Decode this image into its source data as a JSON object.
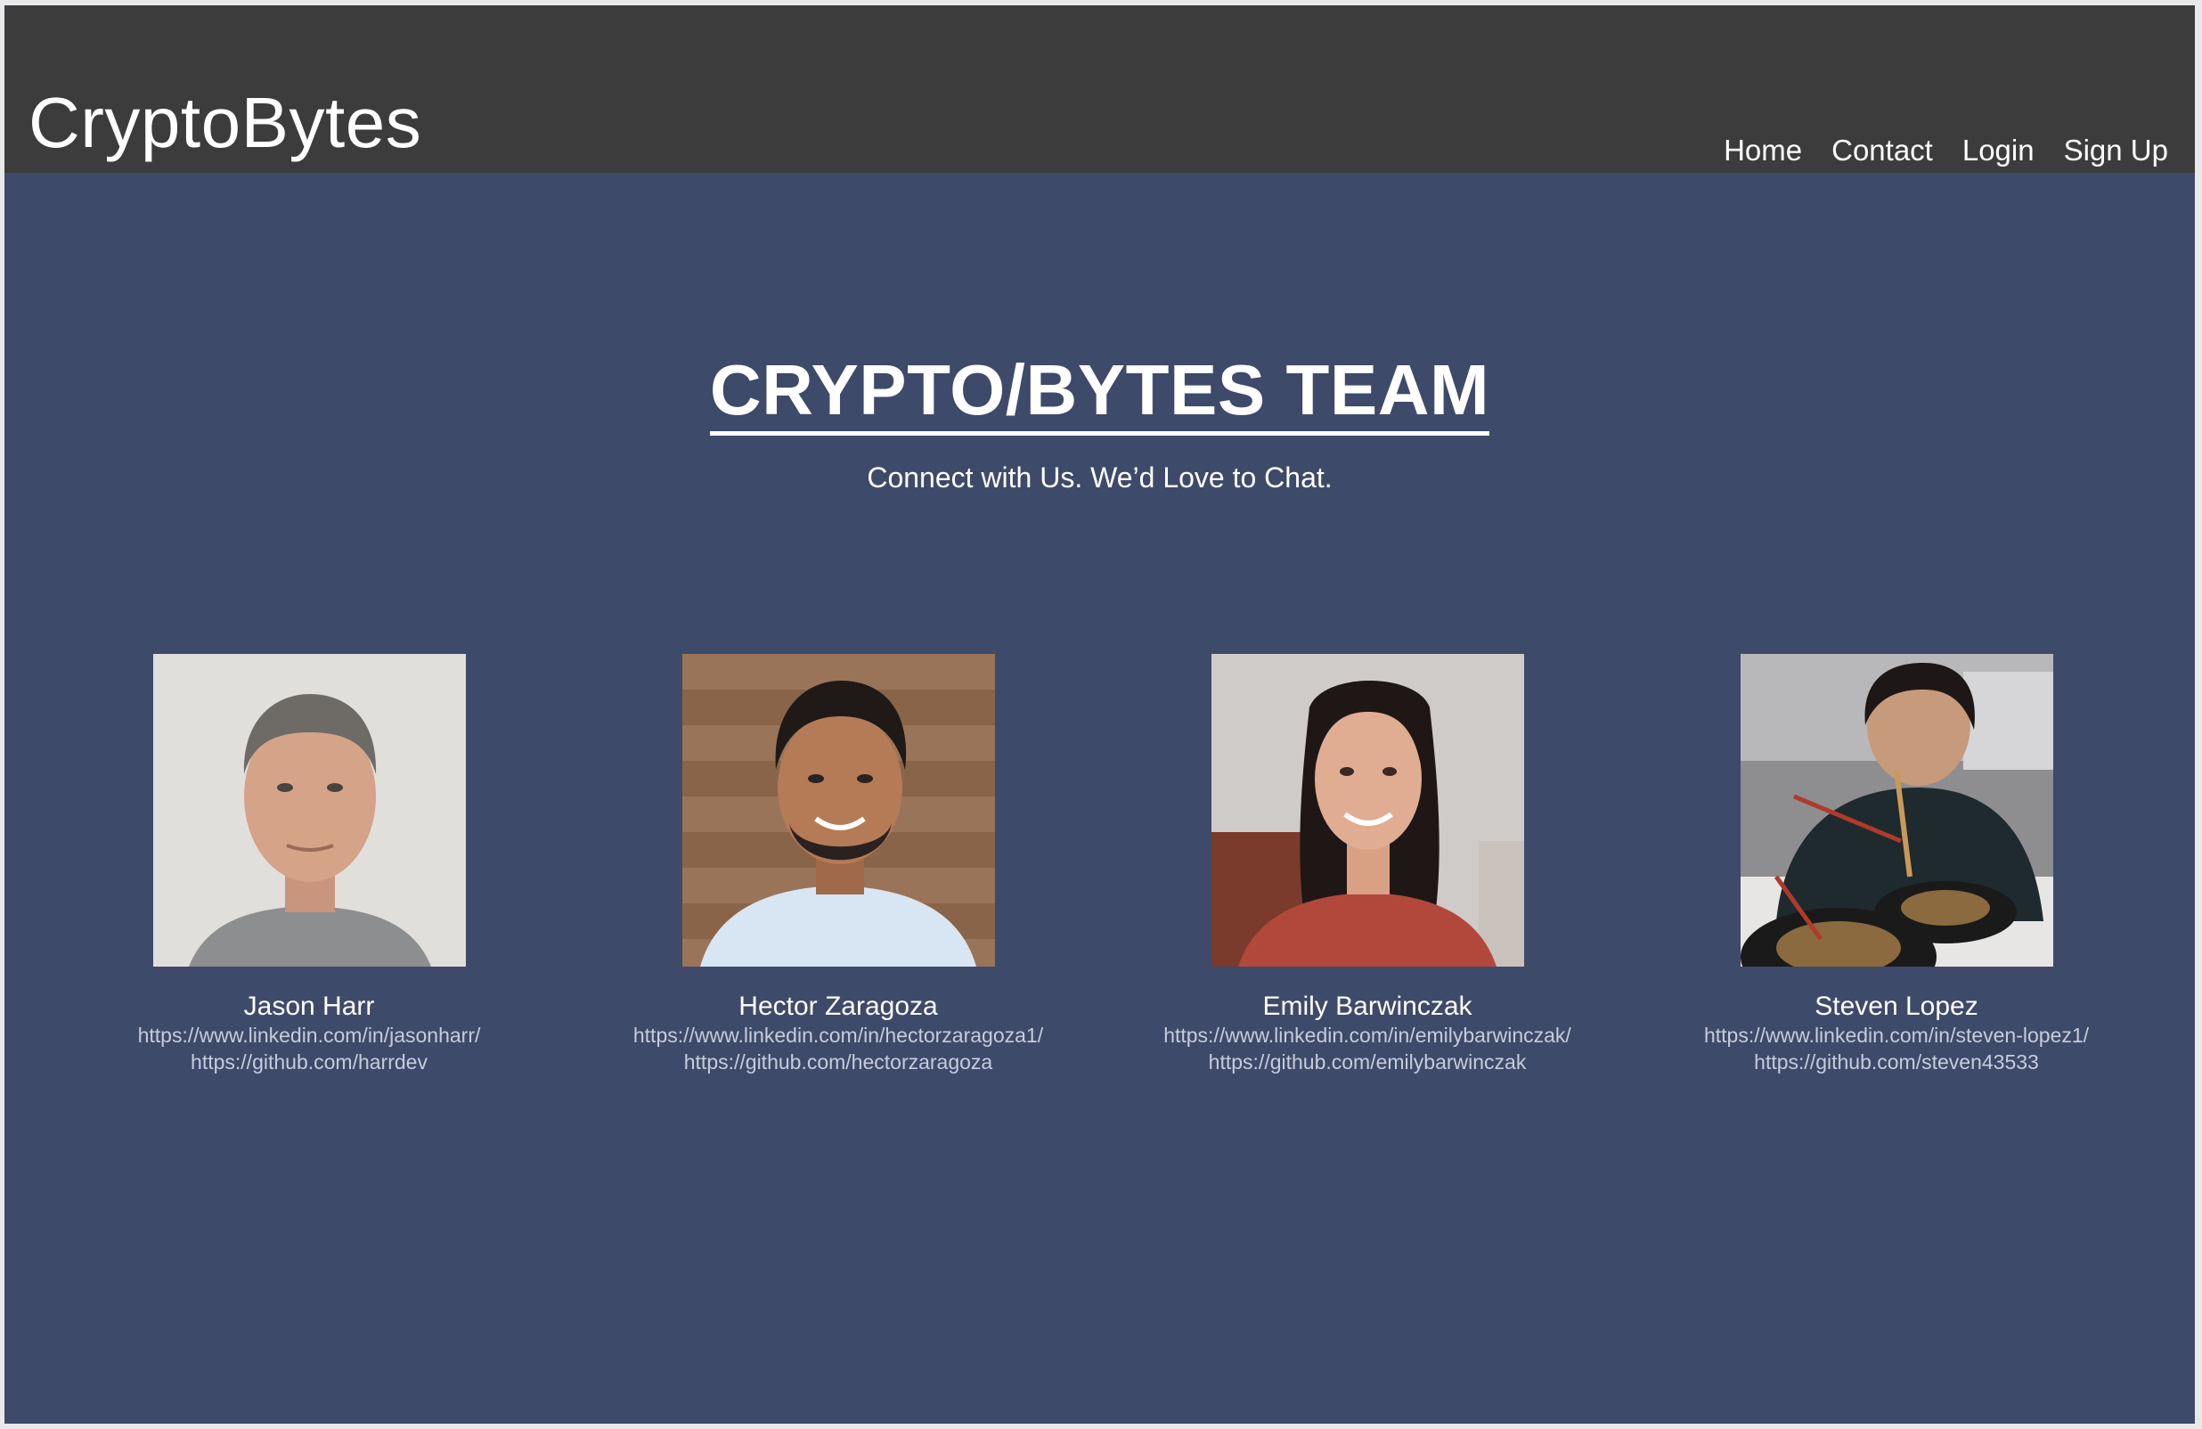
{
  "header": {
    "brand": "CryptoBytes",
    "nav": [
      "Home",
      "Contact",
      "Login",
      "Sign Up"
    ]
  },
  "main": {
    "title": "CRYPTO/BYTES TEAM",
    "subtitle": "Connect with Us. We’d Love to Chat."
  },
  "team": [
    {
      "name": "Jason Harr",
      "linkedin": "https://www.linkedin.com/in/jasonharr/",
      "github": "https://github.com/harrdev"
    },
    {
      "name": "Hector Zaragoza",
      "linkedin": "https://www.linkedin.com/in/hectorzaragoza1/",
      "github": "https://github.com/hectorzaragoza"
    },
    {
      "name": "Emily Barwinczak",
      "linkedin": "https://www.linkedin.com/in/emilybarwinczak/",
      "github": "https://github.com/emilybarwinczak"
    },
    {
      "name": "Steven Lopez",
      "linkedin": "https://www.linkedin.com/in/steven-lopez1/",
      "github": "https://github.com/steven43533"
    }
  ],
  "colors": {
    "header_bg": "#3c3c3c",
    "page_bg": "#3e4a6a",
    "text": "#ffffff",
    "link_text": "#c6ccdc"
  }
}
